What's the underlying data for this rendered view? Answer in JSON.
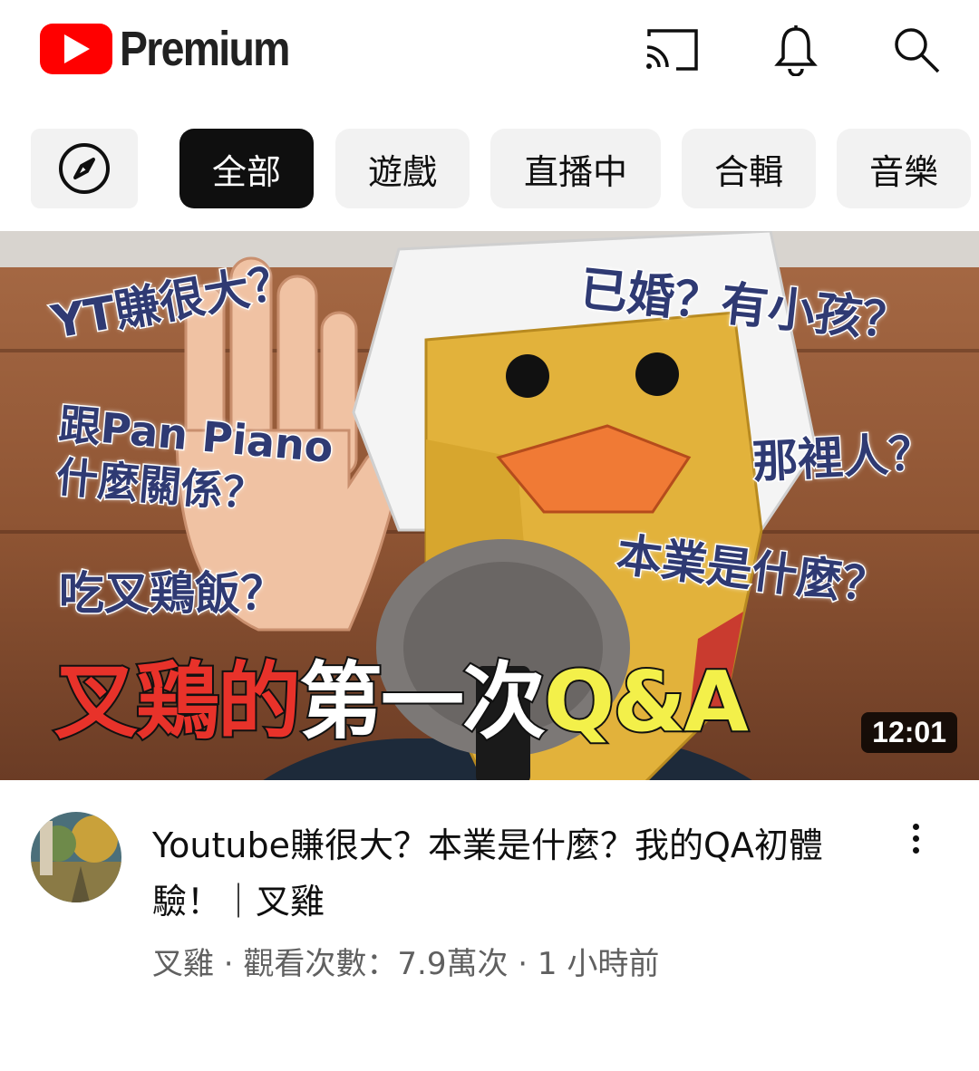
{
  "header": {
    "logo_text": "Premium",
    "icons": [
      "cast-icon",
      "bell-icon",
      "search-icon"
    ]
  },
  "chips": {
    "explore_icon": "compass-icon",
    "items": [
      "全部",
      "遊戲",
      "直播中",
      "合輯",
      "音樂"
    ],
    "selected_index": 0
  },
  "thumbnail": {
    "overlay_texts": {
      "q1": "YT賺很大？",
      "q2": "已婚？有小孩？",
      "q3_line1": "跟Pan Piano",
      "q3_line2": "什麼關係？",
      "q4": "那裡人？",
      "q5": "吃叉鶏飯？",
      "q6": "本業是什麼？"
    },
    "big_title": {
      "part1": "叉鶏",
      "part2": "的",
      "part3": "第一次",
      "part4": "Q&A"
    },
    "duration": "12:01"
  },
  "video": {
    "title": "Youtube賺很大？本業是什麼？我的QA初體驗！｜叉雞",
    "meta": "叉雞 · 觀看次數：7.9萬次 · 1 小時前"
  },
  "colors": {
    "brand_red": "#ff0000",
    "chip_bg": "#f2f2f2",
    "chip_selected_bg": "#0f0f0f",
    "meta_text": "#606060"
  }
}
